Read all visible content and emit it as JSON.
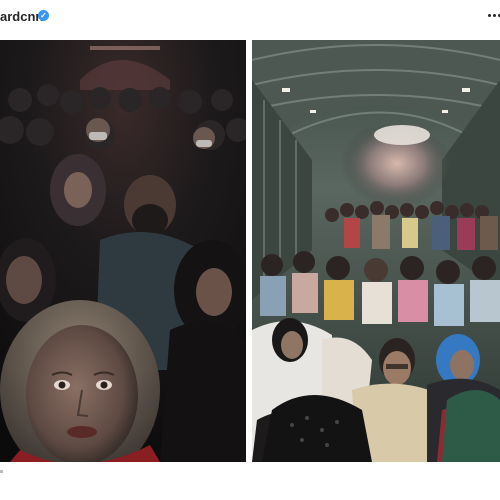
{
  "post": {
    "username": "ardcnn",
    "verified_icon": "verified-badge-icon",
    "menu_icon": "more-options-icon"
  },
  "photos": [
    {
      "name": "selfie-inside-cargo-plane",
      "description_icon": "photo"
    },
    {
      "name": "crowded-cargo-plane-interior",
      "description_icon": "photo"
    }
  ],
  "colors": {
    "verified": "#3897f0",
    "text": "#262626"
  }
}
